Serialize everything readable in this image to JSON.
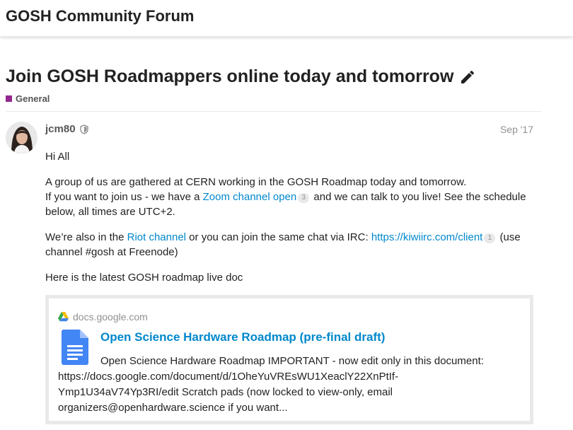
{
  "header": {
    "site_title": "GOSH Community Forum"
  },
  "topic": {
    "title": "Join GOSH Roadmappers online today and tomorrow",
    "category": {
      "name": "General",
      "color": "#92278f"
    }
  },
  "post": {
    "username": "jcm80",
    "date": "Sep '17",
    "greeting": "Hi All",
    "p1_line1": "A group of us are gathered at CERN working in the GOSH Roadmap today and tomorrow.",
    "p1_line2_pre": "If you want to join us - we have a ",
    "p1_link": "Zoom channel open",
    "p1_link_count": "3",
    "p1_line2_post": " and we can talk to you live! See the schedule below, all times are UTC+2.",
    "p2_pre": "We’re also in the ",
    "p2_link1": "Riot channel",
    "p2_mid": " or you can join the same chat via IRC: ",
    "p2_link2": "https://kiwiirc.com/client",
    "p2_link2_count": "1",
    "p2_post": " (use channel #gosh at Freenode)",
    "p3": "Here is the latest GOSH roadmap live doc"
  },
  "onebox": {
    "source": "docs.google.com",
    "title": "Open Science Hardware Roadmap (pre-final draft)",
    "desc_first": "Open Science Hardware Roadmap IMPORTANT - now edit only in this document:",
    "desc_rest": "https://docs.google.com/document/d/1OheYuVREsWU1XeaclY22XnPtIf-Ymp1U34aV74Yp3RI/edit Scratch pads (now locked to view-only, email organizers@openhardware.science if you want..."
  },
  "icons": {
    "edit": "pencil-icon",
    "moderator": "shield-icon",
    "source": "google-drive-icon",
    "document": "google-docs-icon"
  },
  "colors": {
    "link": "#0088cc",
    "muted": "#919191",
    "border": "#e9e9e9",
    "docs_blue": "#4285f4"
  }
}
